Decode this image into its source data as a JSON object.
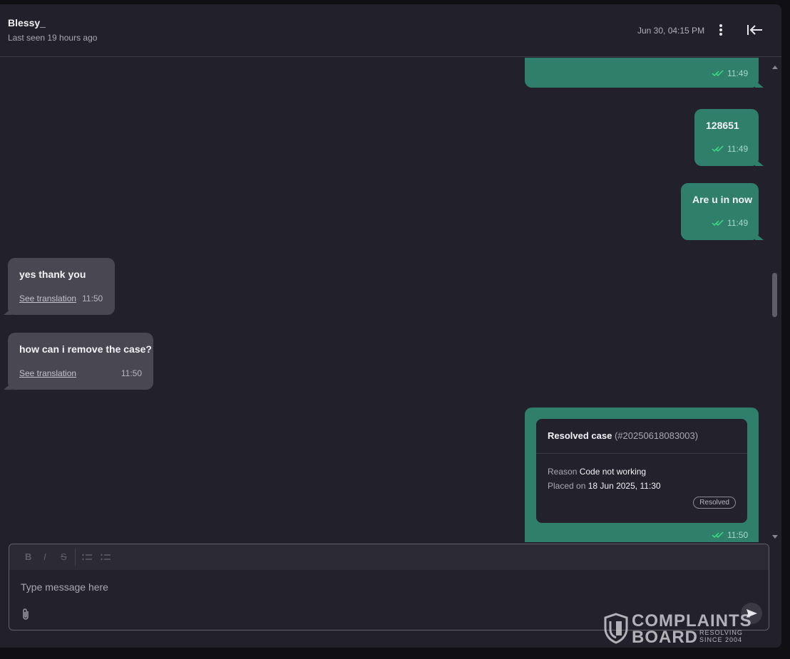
{
  "header": {
    "contact_name": "Blessy_",
    "last_seen": "Last seen 19 hours ago",
    "date": "Jun 30, 04:15 PM"
  },
  "messages": [
    {
      "direction": "out",
      "text": "",
      "time": "11:49",
      "read": true
    },
    {
      "direction": "out",
      "text": "128651",
      "time": "11:49",
      "read": true
    },
    {
      "direction": "out",
      "text": "Are u in now",
      "time": "11:49",
      "read": true
    },
    {
      "direction": "in",
      "text": "yes thank you",
      "translation_link": "See translation",
      "time": "11:50"
    },
    {
      "direction": "in",
      "text": "how can i remove the case?",
      "translation_link": "See translation",
      "time": "11:50"
    },
    {
      "direction": "out",
      "time": "11:50",
      "read": true,
      "case_card": {
        "title": "Resolved case",
        "case_id": "(#20250618083003)",
        "reason_label": "Reason",
        "reason_value": "Code not working",
        "placed_label": "Placed on",
        "placed_value": "18 Jun 2025, 11:30",
        "status": "Resolved"
      }
    }
  ],
  "composer": {
    "toolbar": [
      "B",
      "I",
      "S",
      "ordered-list",
      "bullet-list"
    ],
    "placeholder": "Type message here"
  },
  "watermark": {
    "line1": "COMPLAINTS",
    "line2": "BOARD",
    "tag1": "RESOLVING",
    "tag2": "SINCE 2004"
  },
  "colors": {
    "outgoing_bubble": "#2f7f6b",
    "incoming_bubble": "#484752",
    "background": "#22212b",
    "read_tick": "#3ddc84"
  },
  "icons": [
    "kebab-menu-icon",
    "collapse-panel-icon",
    "double-check-icon",
    "paperclip-icon",
    "send-icon",
    "complaintsboard-shield-logo"
  ]
}
